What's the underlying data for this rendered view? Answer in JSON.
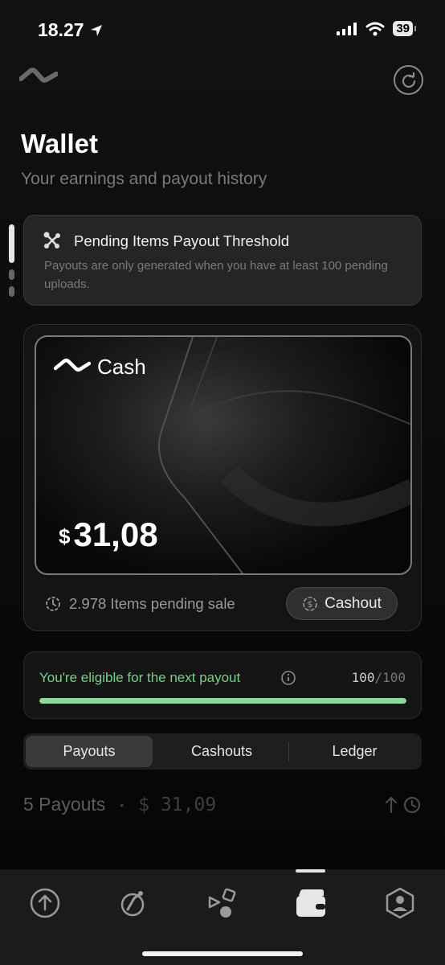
{
  "status_bar": {
    "time": "18.27",
    "battery": "39"
  },
  "header": {
    "title": "Wallet",
    "subtitle": "Your earnings and payout history"
  },
  "notice": {
    "title": "Pending Items Payout Threshold",
    "body": "Payouts are only generated when you have at least 100 pending uploads."
  },
  "wallet": {
    "brand": "Cash",
    "currency": "$",
    "balance": "31,08",
    "pending_text": "2.978 Items pending sale",
    "cashout_label": "Cashout"
  },
  "eligibility": {
    "text": "You're eligible for the next payout",
    "current": "100",
    "total": "/100",
    "progress": 1.0,
    "accent": "#8fd89a"
  },
  "tabs": [
    {
      "label": "Payouts",
      "active": true
    },
    {
      "label": "Cashouts",
      "active": false
    },
    {
      "label": "Ledger",
      "active": false
    }
  ],
  "summary": {
    "count": "5 Payouts",
    "separator": "•",
    "amount": "$ 31,09"
  },
  "bottom_nav": [
    {
      "icon": "upload-icon"
    },
    {
      "icon": "explore-icon"
    },
    {
      "icon": "shapes-icon"
    },
    {
      "icon": "wallet-icon",
      "active": true
    },
    {
      "icon": "profile-icon"
    }
  ]
}
